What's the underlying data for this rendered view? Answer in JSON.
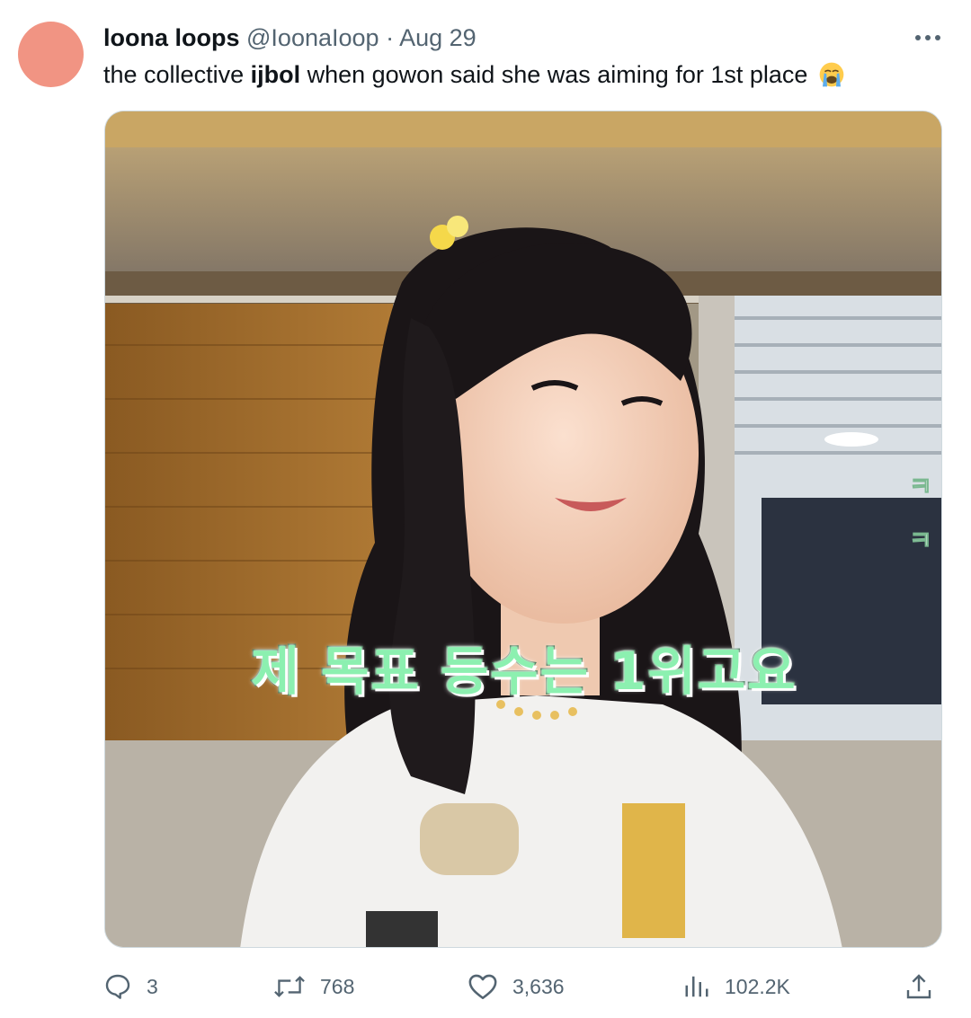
{
  "author": {
    "display_name": "loona loops",
    "handle": "@IoonaIoop",
    "separator": "·",
    "date": "Aug 29",
    "avatar_color": "#F19483"
  },
  "tweet": {
    "text_before": "the collective ",
    "text_bold": "ijbol",
    "text_after": " when gowon said she was aiming for 1st place",
    "emoji": "loudly-crying-face-icon"
  },
  "media": {
    "caption": "제 목표 등수는 1위고요",
    "side_text": [
      "ㅋ",
      "ㅋ"
    ]
  },
  "actions": {
    "replies": "3",
    "reposts": "768",
    "likes": "3,636",
    "views": "102.2K"
  },
  "colors": {
    "text_primary": "#0f1419",
    "text_secondary": "#536471",
    "caption_fill": "#8cf0b0"
  }
}
